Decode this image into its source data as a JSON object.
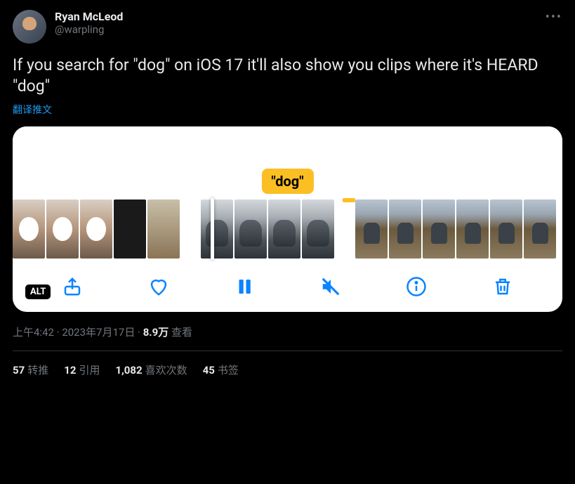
{
  "author": {
    "display_name": "Ryan McLeod",
    "handle": "@warpling"
  },
  "tweet_text": "If you search for \"dog\" on iOS 17 it'll also show you clips where it's HEARD \"dog\"",
  "translate_label": "翻译推文",
  "media": {
    "tag_label": "\"dog\"",
    "alt_badge": "ALT"
  },
  "meta": {
    "time": "上午4:42",
    "date": "2023年7月17日",
    "views_count": "8.9万",
    "views_label": "查看",
    "separator": " · "
  },
  "stats": {
    "retweets": {
      "count": "57",
      "label": "转推"
    },
    "quotes": {
      "count": "12",
      "label": "引用"
    },
    "likes": {
      "count": "1,082",
      "label": "喜欢次数"
    },
    "bookmarks": {
      "count": "45",
      "label": "书签"
    }
  }
}
